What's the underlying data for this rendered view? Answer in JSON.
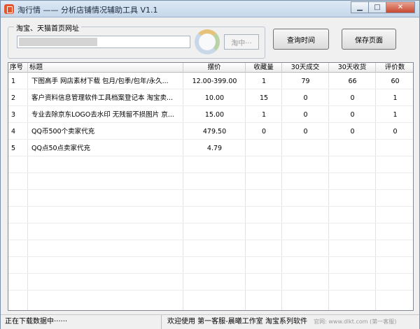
{
  "window": {
    "title": "淘行情 —— 分析店铺情况辅助工具 V1.1",
    "controls": {
      "minimize": "▁",
      "maximize": "□",
      "close": "✕"
    }
  },
  "search": {
    "group_label": "淘宝、天猫首页网址",
    "url_value": "",
    "fetch_label": "淘中···"
  },
  "toolbar": {
    "query_time_label": "查询时间",
    "save_page_label": "保存页面"
  },
  "table": {
    "columns": [
      "序号",
      "标题",
      "摆价",
      "收藏量",
      "30天成交",
      "30天收货",
      "评价数"
    ],
    "rows": [
      [
        "1",
        "下图高手 网店素材下载 包月/包季/包年/永久...",
        "12.00-399.00",
        "1",
        "79",
        "66",
        "60"
      ],
      [
        "2",
        "客户资料信息管理软件工具档案登记本 淘宝卖...",
        "10.00",
        "15",
        "0",
        "0",
        "1"
      ],
      [
        "3",
        "专业去除京东LOGO去水印 无残留不损图片 京...",
        "15.00",
        "1",
        "0",
        "0",
        "1"
      ],
      [
        "4",
        "QQ币500个卖家代充",
        "479.50",
        "0",
        "0",
        "0",
        "0"
      ],
      [
        "5",
        "QQ点50点卖家代充",
        "4.79",
        "",
        "",
        "",
        ""
      ]
    ]
  },
  "status": {
    "left": "正在下载数据中······",
    "right": "欢迎使用 第一客服-晨曦工作室 淘宝系列软件",
    "watermark": "官网: www.dlkt.com (第一客服)"
  }
}
